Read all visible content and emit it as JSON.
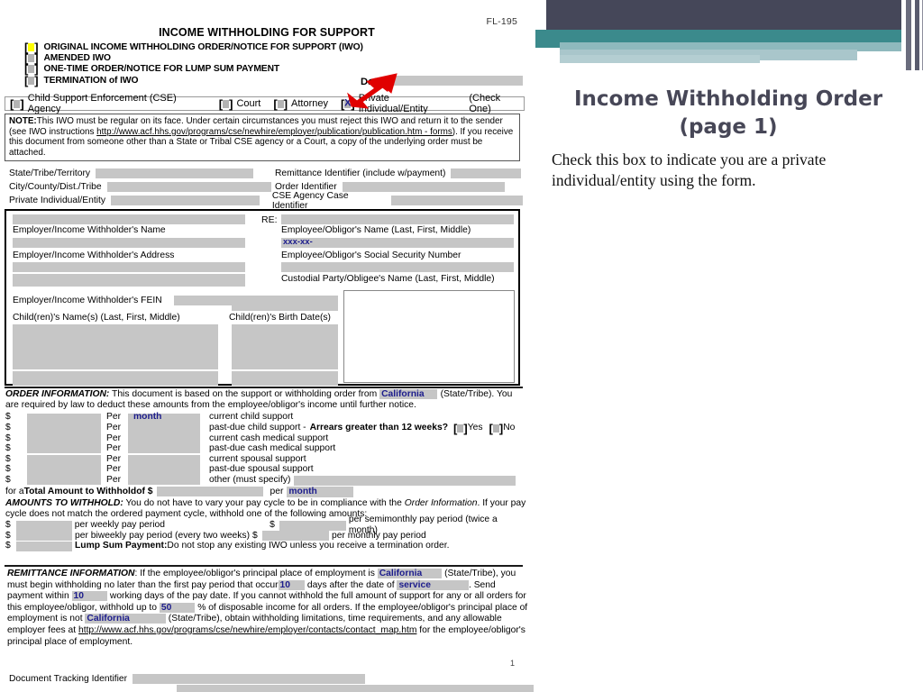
{
  "slide": {
    "title_line1": "Income Withholding Order",
    "title_line2": "(page 1)",
    "caption": "Check this box to indicate you are a private individual/entity using the form.",
    "accent_dark": "#454759",
    "accent_teal": "#3b8a8c",
    "accent_pale": "#a9c6cb",
    "arrow_color": "#e00000"
  },
  "form": {
    "form_number": "FL-195",
    "title": "INCOME WITHHOLDING FOR SUPPORT",
    "page_number": "1",
    "options": [
      {
        "label": "ORIGINAL INCOME WITHHOLDING ORDER/NOTICE FOR SUPPORT (IWO)",
        "checked": false,
        "highlight": true
      },
      {
        "label": "AMENDED IWO",
        "checked": false,
        "highlight": false
      },
      {
        "label": "ONE-TIME ORDER/NOTICE FOR LUMP SUM PAYMENT",
        "checked": false,
        "highlight": false
      },
      {
        "label": "TERMINATION of IWO",
        "checked": false,
        "highlight": false
      }
    ],
    "date_label": "Date:",
    "date_value": "",
    "sender_row": {
      "items": [
        {
          "label": "Child Support Enforcement (CSE) Agency",
          "checked": false
        },
        {
          "label": "Court",
          "checked": false
        },
        {
          "label": "Attorney",
          "checked": false
        },
        {
          "label": "Private Individual/Entity",
          "checked": true
        }
      ],
      "suffix": "(Check One)"
    },
    "note": {
      "lead": "NOTE:",
      "text_1": "This IWO must be regular on its face. Under certain circumstances you must reject this IWO and return it to the sender (see IWO instructions ",
      "link": "http://www.acf.hhs.gov/programs/cse/newhire/employer/publication/publication.htm - forms",
      "text_2": "). If you receive this document from someone other than a State or Tribal CSE agency or a Court, a copy of the underlying order must be attached."
    },
    "identifiers": {
      "left": [
        {
          "label": "State/Tribe/Territory",
          "value": ""
        },
        {
          "label": "City/County/Dist./Tribe",
          "value": ""
        },
        {
          "label": "Private Individual/Entity",
          "value": ""
        }
      ],
      "right": [
        {
          "label": "Remittance Identifier (include w/payment)",
          "value": ""
        },
        {
          "label": "Order Identifier",
          "value": ""
        },
        {
          "label": "CSE Agency Case Identifier",
          "value": ""
        }
      ]
    },
    "parties": {
      "re_label": "RE:",
      "employer_name_label": "Employer/Income Withholder's Name",
      "employer_address_label": "Employer/Income Withholder's Address",
      "employer_fein_label": "Employer/Income Withholder's FEIN",
      "employee_name_label": "Employee/Obligor's Name (Last, First, Middle)",
      "employee_ssn_label": "Employee/Obligor's Social Security Number",
      "employee_ssn_value": "xxx-xx-",
      "custodial_label": "Custodial Party/Obligee's Name (Last, First, Middle)",
      "children_names_label": "Child(ren)'s Name(s) (Last, First, Middle)",
      "children_dob_label": "Child(ren)'s Birth Date(s)"
    },
    "order_information": {
      "heading": "ORDER INFORMATION:",
      "intro_1": " This document is based on the support or withholding order from ",
      "state": "California",
      "intro_2": "(State/Tribe). You are required by law to deduct these amounts from the employee/obligor's income until further notice.",
      "rows": [
        {
          "amount": "",
          "per": "month",
          "description": "current child support"
        },
        {
          "amount": "",
          "per": "",
          "description": "past-due child support -"
        },
        {
          "amount": "",
          "per": "",
          "description": "current cash medical support"
        },
        {
          "amount": "",
          "per": "",
          "description": "past-due cash medical support"
        },
        {
          "amount": "",
          "per": "",
          "description": "current spousal support"
        },
        {
          "amount": "",
          "per": "",
          "description": "past-due spousal support"
        },
        {
          "amount": "",
          "per": "",
          "description": "other (must specify)"
        }
      ],
      "per_label": "Per",
      "arrears_question": "Arrears greater than 12 weeks?",
      "arrears_yes": "Yes",
      "arrears_no": "No",
      "total_prefix": "for a ",
      "total_bold": "Total Amount to Withhold",
      "total_of": " of $",
      "total_value": "",
      "total_per_label": "per",
      "total_per_value": "month"
    },
    "amounts_to_withhold": {
      "heading": "AMOUNTS TO WITHHOLD:",
      "intro": " You do not have to vary your pay cycle to be in compliance with the ",
      "intro_italic": "Order Information",
      "intro_2": ". If your pay cycle does not match the ordered payment cycle, withhold one of the following amounts:",
      "rows": [
        {
          "value": "",
          "label": "per weekly pay period"
        },
        {
          "value": "",
          "label": "per biweekly pay period (every two weeks)"
        },
        {
          "value": "",
          "label": "per semimonthly pay period (twice a month)"
        },
        {
          "value": "",
          "label": "per monthly pay period"
        }
      ],
      "lump_sum_label": "Lump Sum Payment:",
      "lump_sum_value": "",
      "lump_sum_text": " Do not stop any existing IWO unless you receive a termination order."
    },
    "remittance": {
      "heading": "REMITTANCE INFORMATION",
      "t1": ": If the employee/obligor's principal place of employment is ",
      "state_1": "California",
      "t2": " (State/Tribe), you must begin withholding no later than the first pay period that occur",
      "days_1": "10",
      "t3": " days after the date of ",
      "service": "service",
      "t4": ". Send payment within ",
      "days_2": "10",
      "t5": " working days of the pay date. If you cannot withhold the full amount of support for any or all orders for this employee/obligor, withhold up to ",
      "percent": "50",
      "t6": " % of disposable income for all orders. If the employee/obligor's principal place of employment is not ",
      "state_2": "California",
      "t7": " (State/Tribe), obtain withholding limitations, time requirements, and any allowable employer fees at ",
      "link": "http://www.acf.hhs.gov/programs/cse/newhire/employer/contacts/contact_map.htm",
      "t8": " for the employee/obligor's principal place of employment."
    },
    "document_tracking_label": "Document Tracking Identifier",
    "document_tracking_value": ""
  }
}
